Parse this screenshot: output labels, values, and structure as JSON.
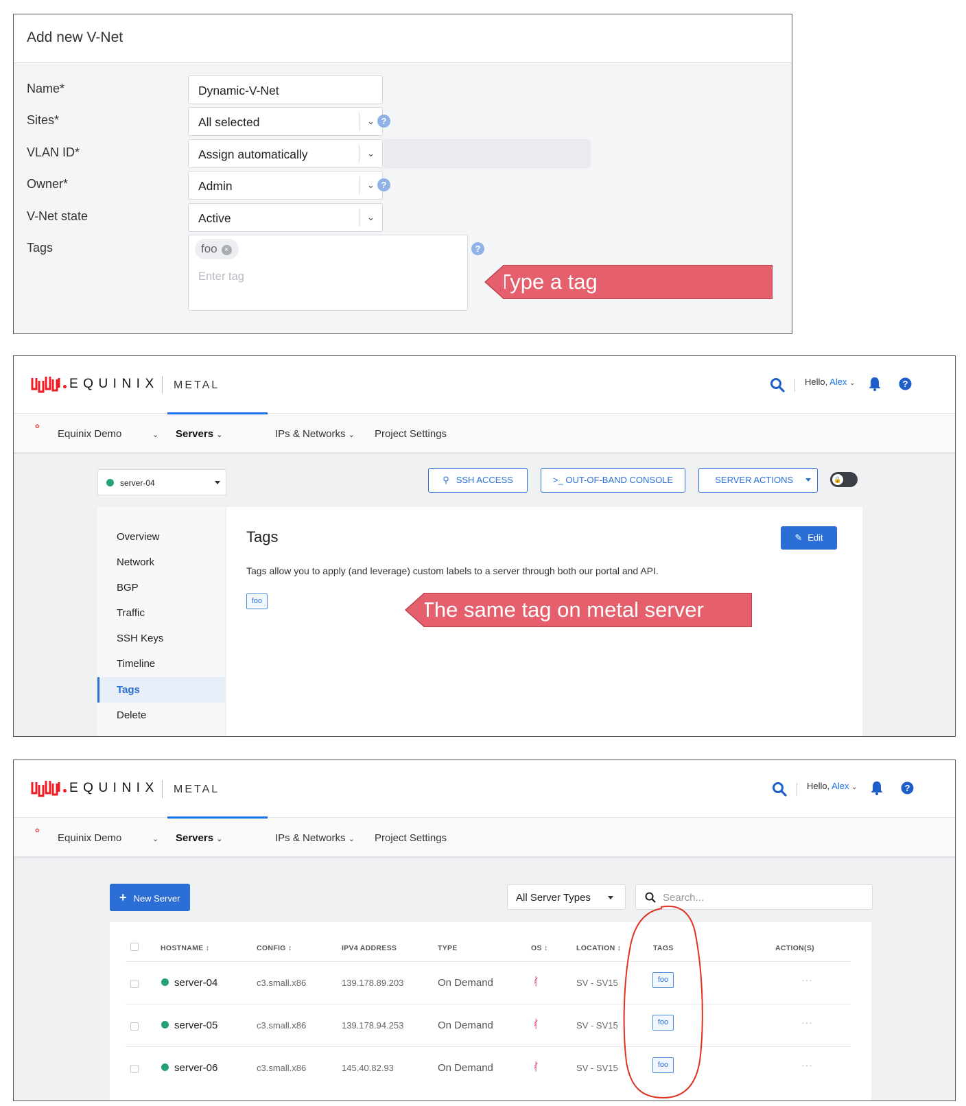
{
  "vnet_form": {
    "title": "Add new V-Net",
    "labels": {
      "name": "Name*",
      "sites": "Sites*",
      "vlan": "VLAN ID*",
      "owner": "Owner*",
      "state": "V-Net state",
      "tags": "Tags"
    },
    "values": {
      "name": "Dynamic-V-Net",
      "sites": "All selected",
      "vlan": "Assign automatically",
      "owner": "Admin",
      "state": "Active"
    },
    "tag_chip": "foo",
    "tag_placeholder": "Enter tag",
    "help_glyph": "?",
    "callout": "Type a tag"
  },
  "equinix": {
    "brand": "EQUINIX",
    "product": "METAL",
    "greeting": "Hello,",
    "user": "Alex",
    "project": "Equinix Demo",
    "nav": {
      "servers": "Servers",
      "ips": "IPs & Networks",
      "settings": "Project Settings"
    },
    "icons": [
      "search-icon",
      "bell-icon",
      "help-icon"
    ]
  },
  "server_detail": {
    "selected_server": "server-04",
    "buttons": {
      "ssh": "SSH ACCESS",
      "console": ">_ OUT-OF-BAND CONSOLE",
      "actions": "SERVER ACTIONS",
      "edit": "Edit"
    },
    "menu": [
      "Overview",
      "Network",
      "BGP",
      "Traffic",
      "SSH Keys",
      "Timeline",
      "Tags",
      "Delete"
    ],
    "active_menu": "Tags",
    "title": "Tags",
    "description": "Tags allow you to apply (and leverage) custom labels to a server through both our portal and API.",
    "tag": "foo",
    "callout": "The same tag on metal server"
  },
  "server_list": {
    "new_button": "New Server",
    "type_filter": "All Server Types",
    "search_placeholder": "Search...",
    "columns": [
      "HOSTNAME ↕",
      "CONFIG ↕",
      "IPV4 ADDRESS",
      "TYPE",
      "OS ↕",
      "LOCATION ↕",
      "TAGS",
      "ACTION(S)"
    ],
    "rows": [
      {
        "hostname": "server-04",
        "config": "c3.small.x86",
        "ipv4": "139.178.89.203",
        "type": "On Demand",
        "location": "SV - SV15",
        "tag": "foo"
      },
      {
        "hostname": "server-05",
        "config": "c3.small.x86",
        "ipv4": "139.178.94.253",
        "type": "On Demand",
        "location": "SV - SV15",
        "tag": "foo"
      },
      {
        "hostname": "server-06",
        "config": "c3.small.x86",
        "ipv4": "145.40.82.93",
        "type": "On Demand",
        "location": "SV - SV15",
        "tag": "foo"
      }
    ]
  },
  "colors": {
    "accent": "#2b6fd6",
    "callout": "#e5606c",
    "status_green": "#24a07d",
    "annotation_red": "#e0311f"
  }
}
